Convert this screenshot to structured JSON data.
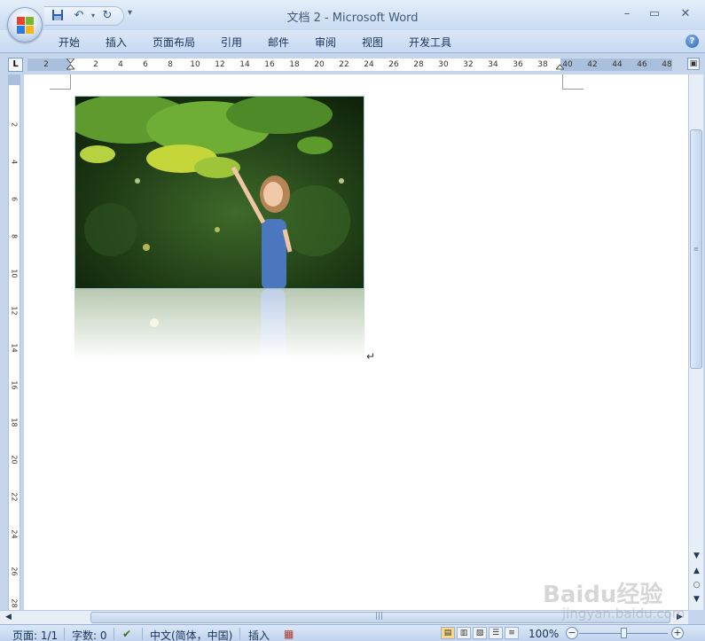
{
  "window": {
    "title": "文档 2 - Microsoft Word",
    "minimize": "–",
    "maximize": "▭",
    "close": "✕"
  },
  "quick_access": {
    "save_icon": "save-icon",
    "undo_icon": "undo-icon",
    "redo_icon": "redo-icon",
    "more": "▾"
  },
  "ribbon": {
    "tabs": [
      "开始",
      "插入",
      "页面布局",
      "引用",
      "邮件",
      "审阅",
      "视图",
      "开发工具"
    ],
    "help": "?"
  },
  "ruler": {
    "tab_selector": "L",
    "numbers": [
      "2",
      "2",
      "4",
      "6",
      "8",
      "10",
      "12",
      "14",
      "16",
      "18",
      "20",
      "22",
      "24",
      "26",
      "28",
      "30",
      "32",
      "34",
      "36",
      "38",
      "40",
      "42",
      "44",
      "46",
      "48"
    ],
    "vertical_numbers": [
      "2",
      "4",
      "6",
      "8",
      "10",
      "12",
      "14",
      "16",
      "18",
      "20",
      "22",
      "24",
      "26",
      "28"
    ]
  },
  "document": {
    "image": "girl-under-tree-photo",
    "effect": "reflection"
  },
  "statusbar": {
    "page": "页面: 1/1",
    "words": "字数: 0",
    "language": "中文(简体，中国)",
    "mode": "插入",
    "zoom": "100%",
    "zoom_minus": "−",
    "zoom_plus": "+"
  },
  "colors": {
    "ribbon": "#c6d9f1",
    "frame": "#c5d6ec",
    "accent": "#15325a"
  },
  "watermark": {
    "brand": "Baidu经验",
    "url": "jingyan.baidu.com"
  }
}
